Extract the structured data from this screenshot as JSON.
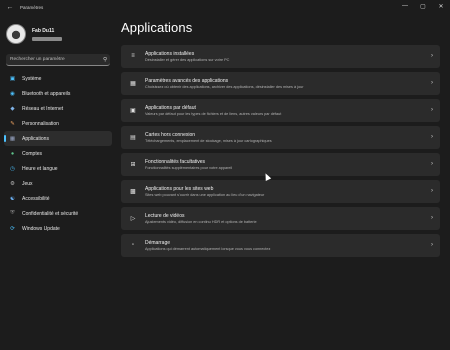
{
  "window": {
    "title": "Paramètres",
    "controls": [
      "—",
      "▢",
      "✕"
    ]
  },
  "profile": {
    "name": "Fab Du11"
  },
  "search": {
    "placeholder": "Rechercher un paramètre"
  },
  "sidebar": {
    "items": [
      {
        "label": "Système",
        "icon": "monitor-icon",
        "color": "#4cc2ff"
      },
      {
        "label": "Bluetooth et appareils",
        "icon": "bluetooth-icon",
        "color": "#4cc2ff"
      },
      {
        "label": "Réseau et Internet",
        "icon": "wifi-icon",
        "color": "#7fb2e6"
      },
      {
        "label": "Personnalisation",
        "icon": "brush-icon",
        "color": "#e8a060"
      },
      {
        "label": "Applications",
        "icon": "apps-icon",
        "color": "#9aa8c8",
        "selected": true
      },
      {
        "label": "Comptes",
        "icon": "account-icon",
        "color": "#5fc48b"
      },
      {
        "label": "Heure et langue",
        "icon": "clock-icon",
        "color": "#4cc2ff"
      },
      {
        "label": "Jeux",
        "icon": "gamepad-icon",
        "color": "#bcbcbc"
      },
      {
        "label": "Accessibilité",
        "icon": "accessibility-icon",
        "color": "#6fb8ff"
      },
      {
        "label": "Confidentialité et sécurité",
        "icon": "shield-icon",
        "color": "#9a9a9a"
      },
      {
        "label": "Windows Update",
        "icon": "update-icon",
        "color": "#4cc2ff"
      }
    ]
  },
  "main": {
    "title": "Applications",
    "cards": [
      {
        "title": "Applications installées",
        "subtitle": "Désinstaller et gérer des applications sur votre PC",
        "icon": "list-icon"
      },
      {
        "title": "Paramètres avancés des applications",
        "subtitle": "Choisissez où obtenir des applications, archiver des applications, désinstaller des mises à jour",
        "icon": "apps-settings-icon"
      },
      {
        "title": "Applications par défaut",
        "subtitle": "Valeurs par défaut pour les types de fichiers et de liens, autres valeurs par défaut",
        "icon": "default-apps-icon"
      },
      {
        "title": "Cartes hors connexion",
        "subtitle": "Téléchargements, emplacement de stockage, mises à jour cartographiques",
        "icon": "map-icon"
      },
      {
        "title": "Fonctionnalités facultatives",
        "subtitle": "Fonctionnalités supplémentaires pour votre appareil",
        "icon": "features-icon"
      },
      {
        "title": "Applications pour les sites web",
        "subtitle": "Sites web pouvant s'ouvrir dans une application au lieu d'un navigateur",
        "icon": "web-apps-icon"
      },
      {
        "title": "Lecture de vidéos",
        "subtitle": "Ajustements vidéo, diffusion en continu HDR et options de batterie",
        "icon": "video-icon"
      },
      {
        "title": "Démarrage",
        "subtitle": "Applications qui démarrent automatiquement lorsque vous vous connectez",
        "icon": "startup-icon"
      }
    ]
  }
}
